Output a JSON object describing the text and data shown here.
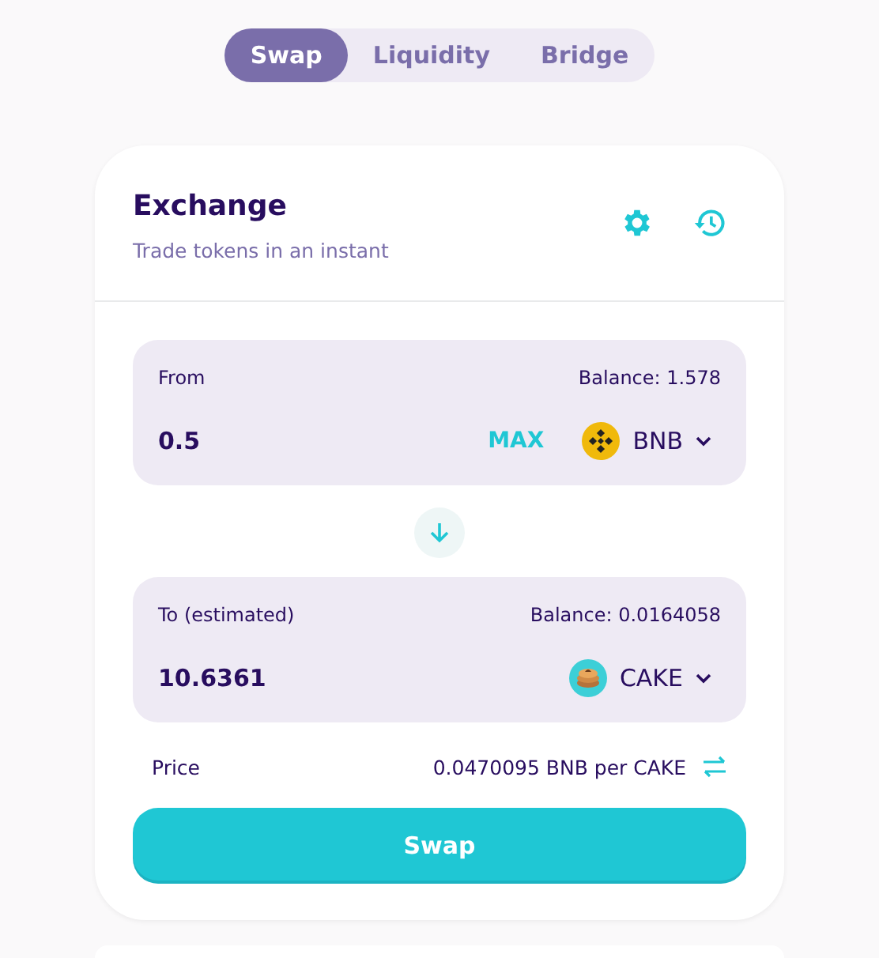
{
  "tabs": [
    {
      "label": "Swap",
      "selected": true
    },
    {
      "label": "Liquidity",
      "selected": false
    },
    {
      "label": "Bridge",
      "selected": false
    }
  ],
  "card": {
    "title": "Exchange",
    "subtitle": "Trade tokens in an instant"
  },
  "panels": [
    {
      "kind": "from",
      "label": "From",
      "balance": "Balance: 1.578",
      "amount": "0.5",
      "max": "MAX",
      "token": "BNB"
    },
    {
      "kind": "to",
      "label": "To (estimated)",
      "balance": "Balance: 0.0164058",
      "amount": "10.6361",
      "token": "CAKE"
    }
  ],
  "price": {
    "label": "Price",
    "value": "0.0470095 BNB per CAKE"
  },
  "swap_button": "Swap"
}
